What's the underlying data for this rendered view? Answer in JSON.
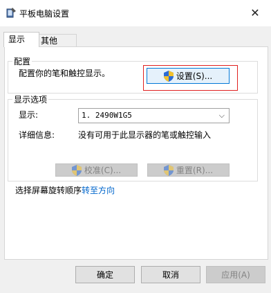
{
  "window": {
    "title": "平板电脑设置",
    "close_icon": "close-icon"
  },
  "tabs": [
    {
      "label": "显示",
      "active": true
    },
    {
      "label": "其他",
      "active": false
    }
  ],
  "config_group": {
    "legend": "配置",
    "description": "配置你的笔和触控显示。",
    "setup_button": "设置(S)..."
  },
  "display_group": {
    "legend": "显示选项",
    "display_label": "显示:",
    "display_value": "1. 2490W1G5",
    "detail_label": "详细信息:",
    "detail_value": "没有可用于此显示器的笔或触控输入",
    "calibrate_button": "校准(C)...",
    "reset_button": "重置(R)..."
  },
  "rotation": {
    "prefix": "选择屏幕旋转顺序",
    "link": "转至方向"
  },
  "footer": {
    "ok": "确定",
    "cancel": "取消",
    "apply": "应用(A)"
  },
  "colors": {
    "accent": "#0078d7",
    "link": "#0066cc",
    "highlight": "#e0201f"
  }
}
